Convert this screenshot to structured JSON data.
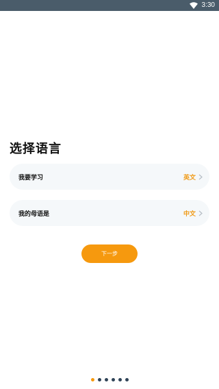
{
  "status_bar": {
    "time": "3:30"
  },
  "page": {
    "title": "选择语言"
  },
  "options": [
    {
      "label": "我要学习",
      "value": "英文",
      "icon": "chevron-right-icon"
    },
    {
      "label": "我的母语是",
      "value": "中文",
      "icon": "chevron-right-icon"
    }
  ],
  "next_button": {
    "label": "下一步"
  },
  "pager": {
    "count": 6,
    "active_index": 0
  },
  "colors": {
    "status_bar": "#4a5c6a",
    "accent": "#f6990e",
    "value_text": "#f09a16",
    "card_bg": "#f5f8fa",
    "dot_inactive": "#2f4357"
  }
}
